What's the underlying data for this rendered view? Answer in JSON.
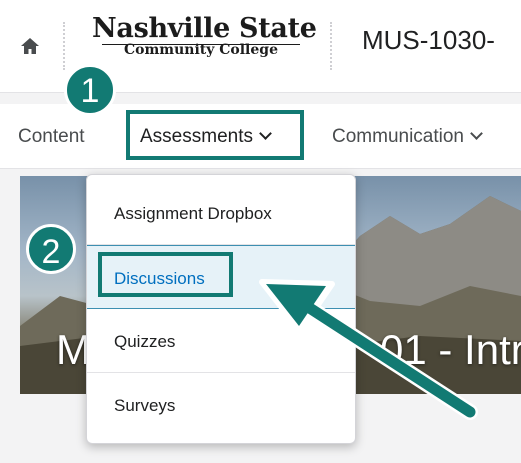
{
  "header": {
    "home_icon": "home-icon",
    "logo_line1": "Nashville State",
    "logo_line2": "Community College",
    "course_code": "MUS-1030-"
  },
  "nav": {
    "items": [
      {
        "label": "Content"
      },
      {
        "label": "Assessments"
      },
      {
        "label": "Communication"
      }
    ]
  },
  "banner": {
    "text_left": "M",
    "text_right": "01 - Intr"
  },
  "dropdown": {
    "items": [
      {
        "label": "Assignment Dropbox"
      },
      {
        "label": "Discussions"
      },
      {
        "label": "Quizzes"
      },
      {
        "label": "Surveys"
      }
    ]
  },
  "annotations": {
    "step1": "1",
    "step2": "2",
    "accent_color": "#127a73"
  }
}
